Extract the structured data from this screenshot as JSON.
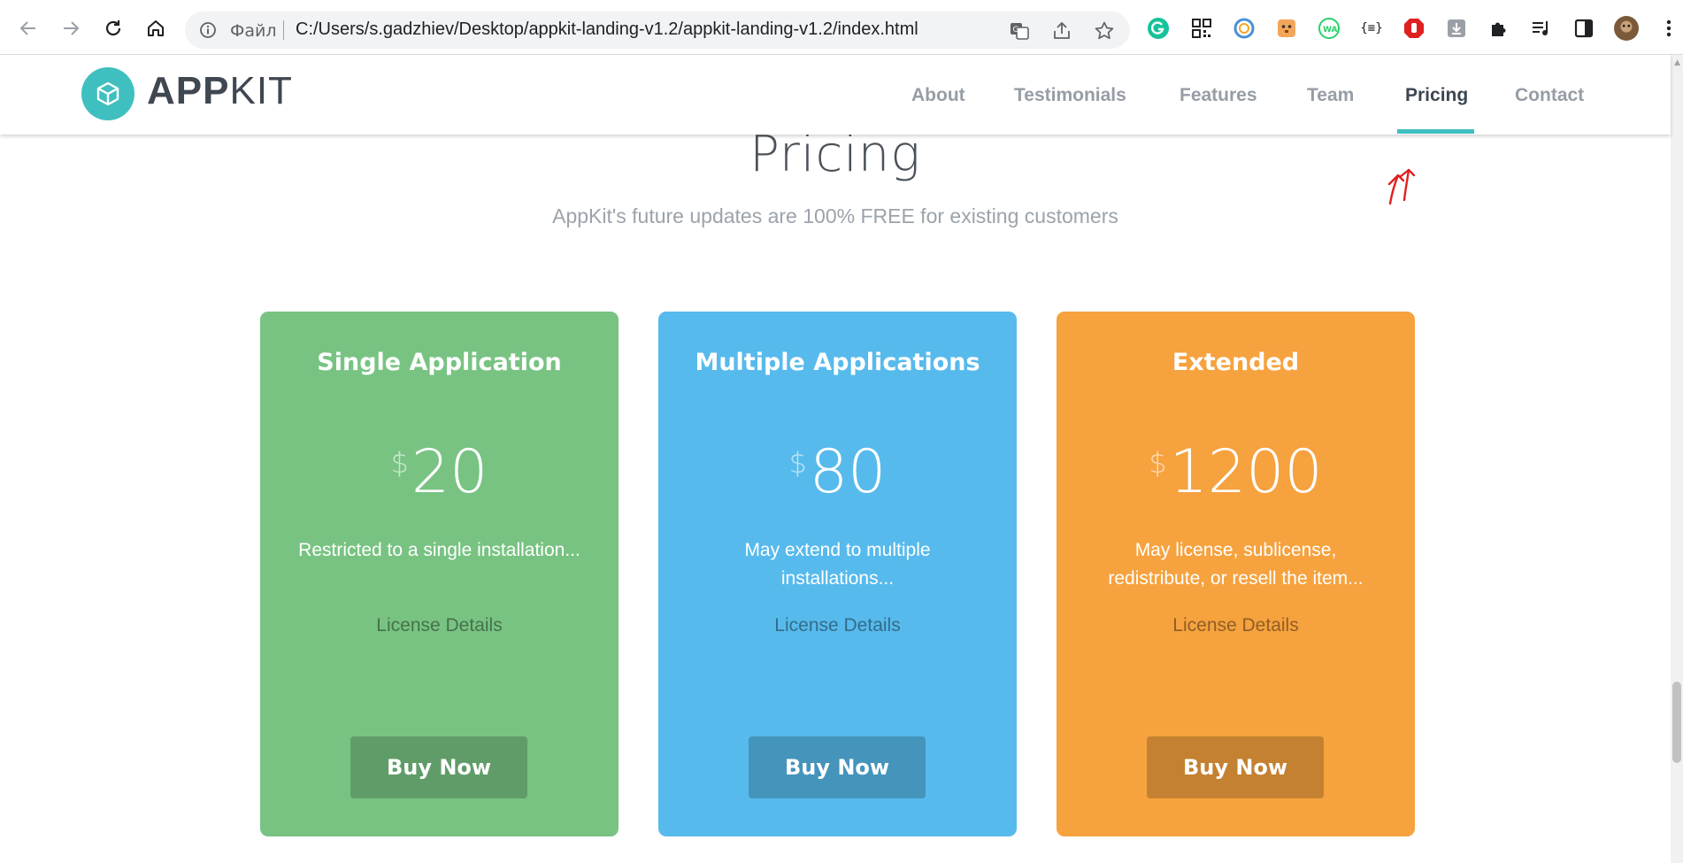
{
  "browser": {
    "scheme_label": "Файл",
    "url": "C:/Users/s.gadzhiev/Desktop/appkit-landing-v1.2/appkit-landing-v1.2/index.html",
    "extensions": [
      "grammarly-icon",
      "qr-code-icon",
      "circle-extension-icon",
      "fox-extension-icon",
      "whatsapp-extension-icon",
      "json-extension-icon",
      "adblock-icon",
      "download-icon",
      "extensions-puzzle-icon",
      "media-control-icon",
      "side-panel-icon",
      "profile-avatar",
      "more-menu-icon"
    ],
    "json_ext_label": "{≡}",
    "wa_label": "WA"
  },
  "site": {
    "logo_strong": "APP",
    "logo_light": "KIT",
    "nav": [
      {
        "label": "About"
      },
      {
        "label": "Testimonials"
      },
      {
        "label": "Features"
      },
      {
        "label": "Team"
      },
      {
        "label": "Pricing",
        "active": true
      },
      {
        "label": "Contact"
      }
    ],
    "accent_color": "#3fbfc0"
  },
  "pricing": {
    "title": "Pricing",
    "subtitle": "AppKit's future updates are 100% FREE for existing customers",
    "plans": [
      {
        "name": "Single Application",
        "currency": "$",
        "price": "20",
        "description": "Restricted to a single installation...",
        "details_link": "License Details",
        "button": "Buy Now",
        "color": "#78c382"
      },
      {
        "name": "Multiple Applications",
        "currency": "$",
        "price": "80",
        "description": "May extend to multiple installations...",
        "details_link": "License Details",
        "button": "Buy Now",
        "color": "#57baec"
      },
      {
        "name": "Extended",
        "currency": "$",
        "price": "1200",
        "description": "May license, sublicense, redistribute, or resell the item...",
        "details_link": "License Details",
        "button": "Buy Now",
        "color": "#f6a23e"
      }
    ]
  }
}
